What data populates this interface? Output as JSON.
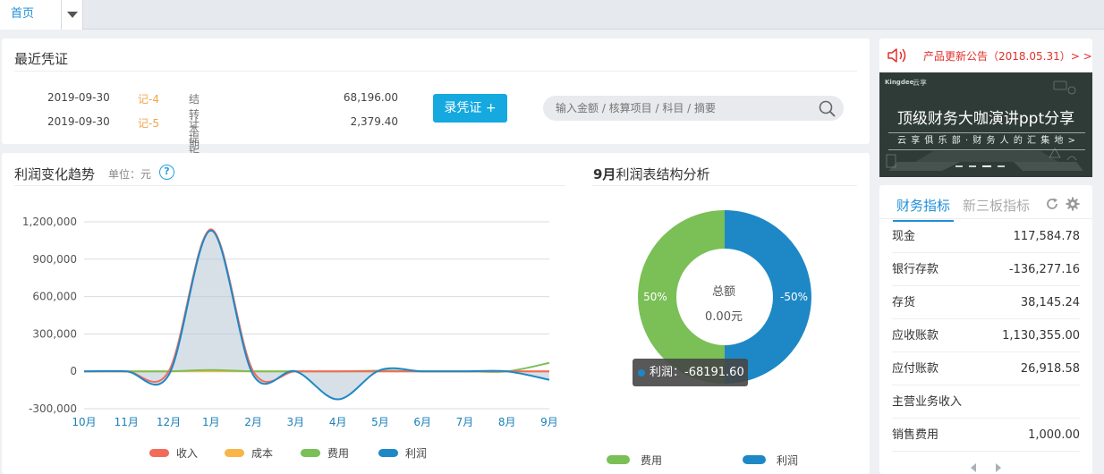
{
  "tabs": {
    "home": "首页"
  },
  "recent": {
    "title": "最近凭证",
    "rows": [
      {
        "date": "2019-09-30",
        "code": "记-4",
        "desc": "结转本期损益",
        "amount": "68,196.00"
      },
      {
        "date": "2019-09-30",
        "code": "记-5",
        "desc": "计提折旧费用",
        "amount": "2,379.40"
      }
    ],
    "record_button": "录凭证 +",
    "search_placeholder": "输入金额 / 核算项目 / 科目 / 摘要"
  },
  "trend": {
    "title": "利润变化趋势",
    "unit": "单位：元",
    "help": "?"
  },
  "structure": {
    "title_bold": "9月",
    "title_rest": "利润表结构分析",
    "center_label": "总额",
    "center_value": "0.00元",
    "tooltip": "利润：-68191.60"
  },
  "notice": {
    "text": "产品更新公告（2018.05.31）> >"
  },
  "banner": {
    "logo": "Kingdee",
    "logo2": "云享",
    "headline": "顶级财务大咖演讲ppt分享",
    "subline": "云 享 俱 乐 部 · 财 务 人 的 汇 集 地  >"
  },
  "financial": {
    "tab_active": "财务指标",
    "tab_inactive": "新三板指标",
    "rows": [
      {
        "k": "现金",
        "v": "117,584.78"
      },
      {
        "k": "银行存款",
        "v": "-136,277.16"
      },
      {
        "k": "存货",
        "v": "38,145.24"
      },
      {
        "k": "应收账款",
        "v": "1,130,355.00"
      },
      {
        "k": "应付账款",
        "v": "26,918.58"
      },
      {
        "k": "主营业务收入",
        "v": ""
      },
      {
        "k": "销售费用",
        "v": "1,000.00"
      }
    ]
  },
  "colors": {
    "income": "#f26b5b",
    "cost": "#f7b54a",
    "expense": "#7bbf57",
    "profit": "#1e88c6",
    "accent": "#15a9e0"
  },
  "chart_data": [
    {
      "type": "line",
      "categories": [
        "10月",
        "11月",
        "12月",
        "1月",
        "2月",
        "3月",
        "4月",
        "5月",
        "6月",
        "7月",
        "8月",
        "9月"
      ],
      "ylim": [
        -300000,
        1200000
      ],
      "yticks": [
        "1,200,000",
        "900,000",
        "600,000",
        "300,000",
        "0",
        "-300,000"
      ],
      "series": [
        {
          "name": "收入",
          "values": [
            0,
            0,
            0,
            1140000,
            0,
            0,
            0,
            0,
            0,
            0,
            0,
            0
          ]
        },
        {
          "name": "成本",
          "values": [
            0,
            0,
            0,
            0,
            0,
            0,
            0,
            0,
            0,
            0,
            0,
            0
          ]
        },
        {
          "name": "费用",
          "values": [
            0,
            0,
            0,
            10000,
            0,
            0,
            0,
            5000,
            0,
            0,
            0,
            68000
          ]
        },
        {
          "name": "利润",
          "values": [
            0,
            0,
            -30000,
            1130000,
            -30000,
            0,
            -225000,
            10000,
            0,
            0,
            0,
            -68000
          ]
        }
      ],
      "grid": true,
      "legend": "bottom"
    },
    {
      "type": "pie",
      "donut": true,
      "series": [
        {
          "name": "费用",
          "label": "50%",
          "value": 50
        },
        {
          "name": "利润",
          "label": "-50%",
          "value": 50
        }
      ],
      "legend": "bottom"
    }
  ]
}
